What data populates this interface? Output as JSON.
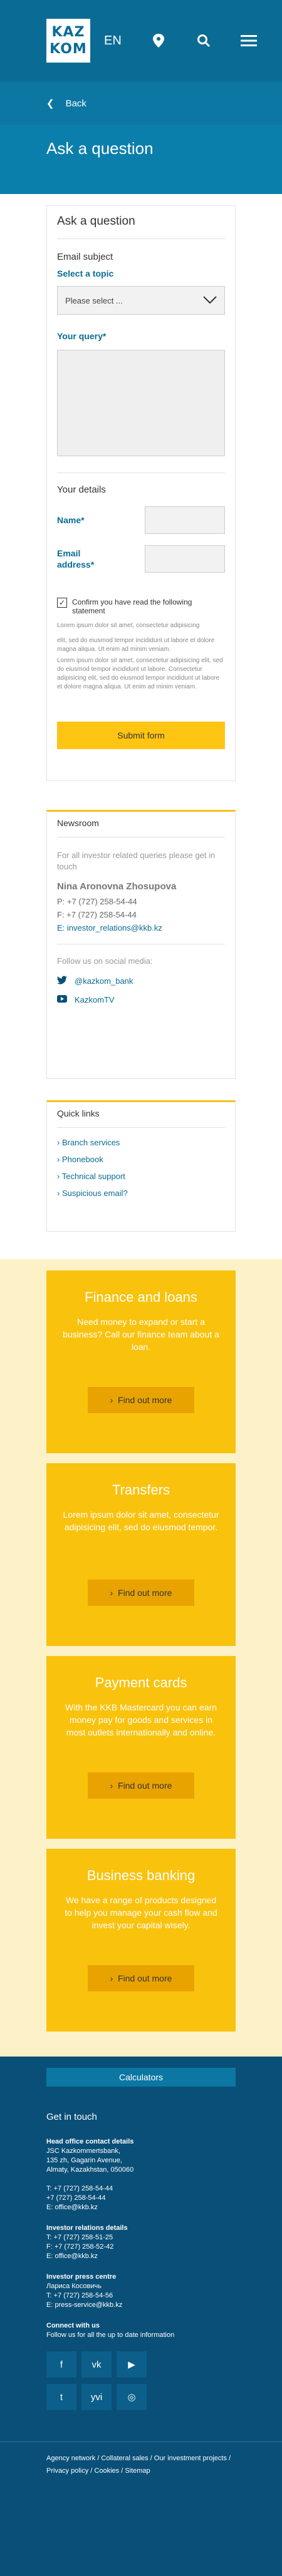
{
  "header": {
    "logo_line1": "KAZ",
    "logo_line2": "KOM",
    "lang": "EN",
    "icons": [
      "location-icon",
      "search-icon",
      "menu-icon"
    ]
  },
  "back_label": "Back",
  "page_title": "Ask a question",
  "form": {
    "title": "Ask a question",
    "email_subject": "Email subject",
    "select_topic": "Select a topic",
    "select_placeholder": "Please select ...",
    "query_label": "Your query*",
    "details": "Your details",
    "name_label": "Name*",
    "email_label": "Email address*",
    "confirm": "Confirm you have read the following statement",
    "lorem": [
      "Lorem ipsum dolor sit amet, consectetur adipisicing",
      "elit, sed do eiusmod tempor incididunt ut labore et dolore magna aliqua. Ut enim ad minim veniam.",
      "Lorem ipsum dolor sit amet, consectetur adipisicing elit, sed do eiusmod tempor incididunt ut labore. Consectetur adipisicing elit, sed do eiusmod tempor incididunt ut labore et dolore magna aliqua. Ut enim ad minim veniam."
    ],
    "submit": "Submit form"
  },
  "newsroom": {
    "title": "Newsroom",
    "intro": "For all investor related queries please get in touch",
    "contact_name": "Nina Aronovna Zhosupova",
    "phone1": "P: +7 (727) 258-54-44",
    "phone2": "F: +7 (727) 258-54-44",
    "email": "E: investor_relations@kkb.kz",
    "follow": "Follow us on social media:",
    "twitter": "@kazkom_bank",
    "youtube": "KazkomTV"
  },
  "quick_links": {
    "title": "Quick links",
    "items": [
      "Branch services",
      "Phonebook",
      "Technical support",
      "Suspicious email?"
    ]
  },
  "promos": [
    {
      "title": "Finance and loans",
      "text": "Need money to expand or start a business? Call our finance team about a loan.",
      "btn": "Find out more"
    },
    {
      "title": "Transfers",
      "text": "Lorem ipsum dolor sit amet, consectetur adipisicing elit, sed do eiusmod tempor.",
      "btn": "Find out more"
    },
    {
      "title": "Payment cards",
      "text": "With the KKB Mastercard you can earn money pay for goods and services in most outlets internationally and online.",
      "btn": "Find out more"
    },
    {
      "title": "Business banking",
      "text": "We have a range of products designed to help you manage your cash flow and invest your capital wisely.",
      "btn": "Find out more"
    }
  ],
  "footer": {
    "calculators": "Calculators",
    "get_in_touch": "Get in touch",
    "blocks": [
      {
        "title": "Head office contact details",
        "lines": [
          "JSC Kazkommertsbank,",
          "135 zh, Gagarin Avenue,",
          "Almaty, Kazakhstan, 050060",
          "",
          "T: +7 (727) 258-54-44",
          "    +7 (727) 258-54-44",
          "E: office@kkb.kz"
        ]
      },
      {
        "title": "Investor relations details",
        "lines": [
          "T: +7 (727) 258-51-25",
          "F: +7 (727) 258-52-42",
          "E: office@kkb.kz"
        ]
      },
      {
        "title": "Investor press centre",
        "lines": [
          "Лариса Косовичь",
          "T: +7 (727) 258-54-56",
          "E: press-service@kkb.kz"
        ]
      },
      {
        "title": "Connect with us",
        "lines": [
          "Follow us for all the up to date information"
        ]
      }
    ],
    "social_icons": [
      "f",
      "vk",
      "▶",
      "t",
      "yvi",
      "◎"
    ],
    "links": "Agency network  /  Collateral sales  /  Our investment projects  /  Privacy policy  /  Cookies  /  Sitemap"
  }
}
